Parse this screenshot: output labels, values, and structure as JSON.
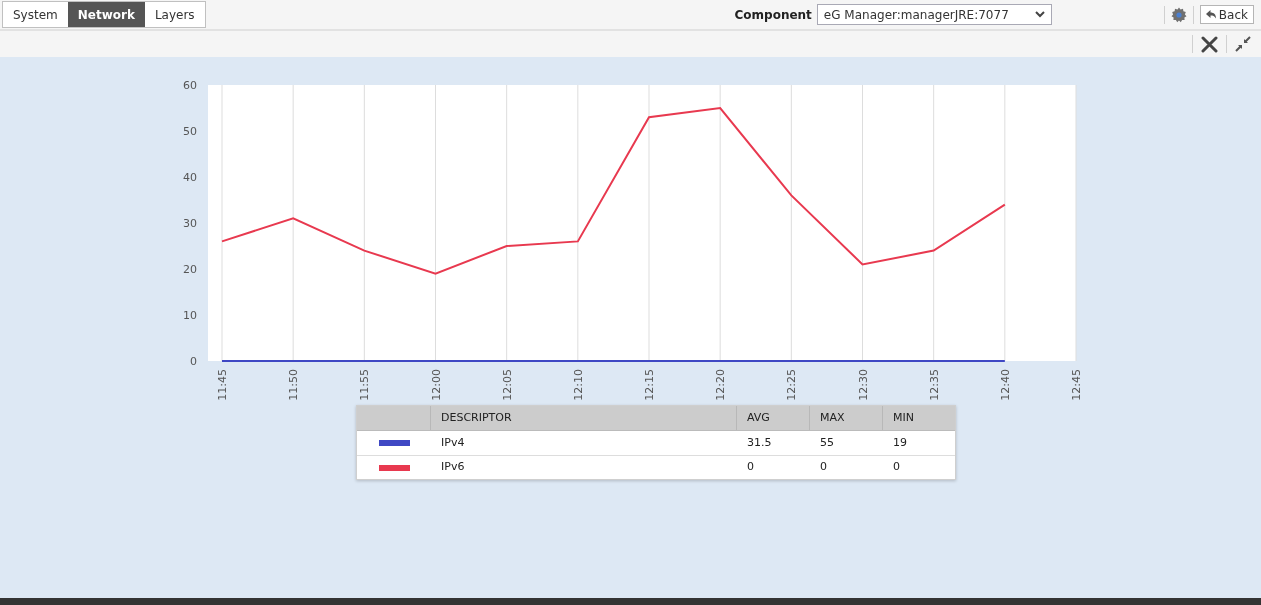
{
  "tabs": [
    {
      "label": "System",
      "selected": false
    },
    {
      "label": "Network",
      "selected": true
    },
    {
      "label": "Layers",
      "selected": false
    }
  ],
  "component": {
    "label": "Component",
    "value": "eG Manager:managerJRE:7077"
  },
  "back_button": "Back",
  "chart_data": {
    "type": "line",
    "categories": [
      "11:45",
      "11:50",
      "11:55",
      "12:00",
      "12:05",
      "12:10",
      "12:15",
      "12:20",
      "12:25",
      "12:30",
      "12:35",
      "12:40",
      "12:45"
    ],
    "series": [
      {
        "color": "#3f48c4",
        "values": [
          0,
          0,
          0,
          0,
          0,
          0,
          0,
          0,
          0,
          0,
          0,
          0,
          null
        ]
      },
      {
        "color": "#e8394f",
        "values": [
          26,
          31,
          24,
          19,
          25,
          26,
          53,
          55,
          36,
          21,
          24,
          34,
          null
        ]
      }
    ],
    "ylim": [
      0,
      60
    ],
    "grid": true,
    "yticks": [
      0,
      10,
      20,
      30,
      40,
      50,
      60
    ]
  },
  "table": {
    "columns": [
      "DESCRIPTOR",
      "AVG",
      "MAX",
      "MIN"
    ],
    "rows": [
      {
        "color": "#3f48c4",
        "descriptor": "IPv4",
        "avg": "31.5",
        "max": "55",
        "min": "19"
      },
      {
        "color": "#e8394f",
        "descriptor": "IPv6",
        "avg": "0",
        "max": "0",
        "min": "0"
      }
    ]
  }
}
